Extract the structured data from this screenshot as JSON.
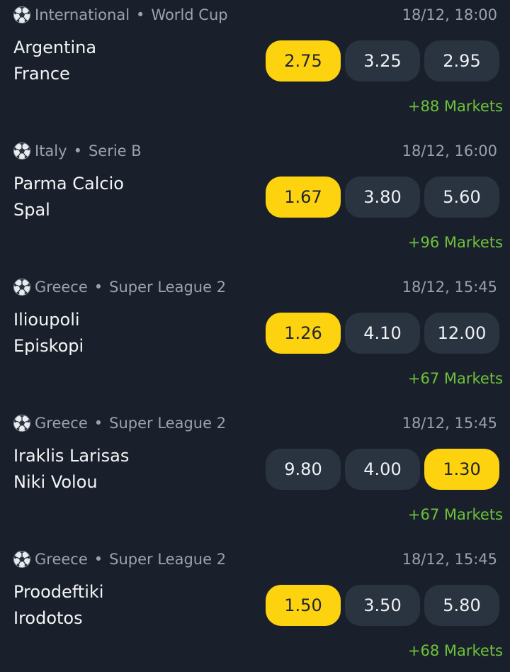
{
  "colors": {
    "background": "#1a202b",
    "odd_default": "#2a3340",
    "odd_selected": "#fdd20e",
    "markets_link": "#6cc23a",
    "muted_text": "#9aa2ae"
  },
  "sport_icon": "soccer-ball-icon",
  "separator": "•",
  "matches": [
    {
      "country": "International",
      "league": "World Cup",
      "datetime": "18/12, 18:00",
      "home": "Argentina",
      "away": "France",
      "odds": [
        "2.75",
        "3.25",
        "2.95"
      ],
      "selected_index": 0,
      "markets": "+88 Markets"
    },
    {
      "country": "Italy",
      "league": "Serie B",
      "datetime": "18/12, 16:00",
      "home": "Parma Calcio",
      "away": "Spal",
      "odds": [
        "1.67",
        "3.80",
        "5.60"
      ],
      "selected_index": 0,
      "markets": "+96 Markets"
    },
    {
      "country": "Greece",
      "league": "Super League 2",
      "datetime": "18/12, 15:45",
      "home": "Ilioupoli",
      "away": "Episkopi",
      "odds": [
        "1.26",
        "4.10",
        "12.00"
      ],
      "selected_index": 0,
      "markets": "+67 Markets"
    },
    {
      "country": "Greece",
      "league": "Super League 2",
      "datetime": "18/12, 15:45",
      "home": "Iraklis Larisas",
      "away": "Niki Volou",
      "odds": [
        "9.80",
        "4.00",
        "1.30"
      ],
      "selected_index": 2,
      "markets": "+67 Markets"
    },
    {
      "country": "Greece",
      "league": "Super League 2",
      "datetime": "18/12, 15:45",
      "home": "Proodeftiki",
      "away": "Irodotos",
      "odds": [
        "1.50",
        "3.50",
        "5.80"
      ],
      "selected_index": 0,
      "markets": "+68 Markets"
    }
  ]
}
